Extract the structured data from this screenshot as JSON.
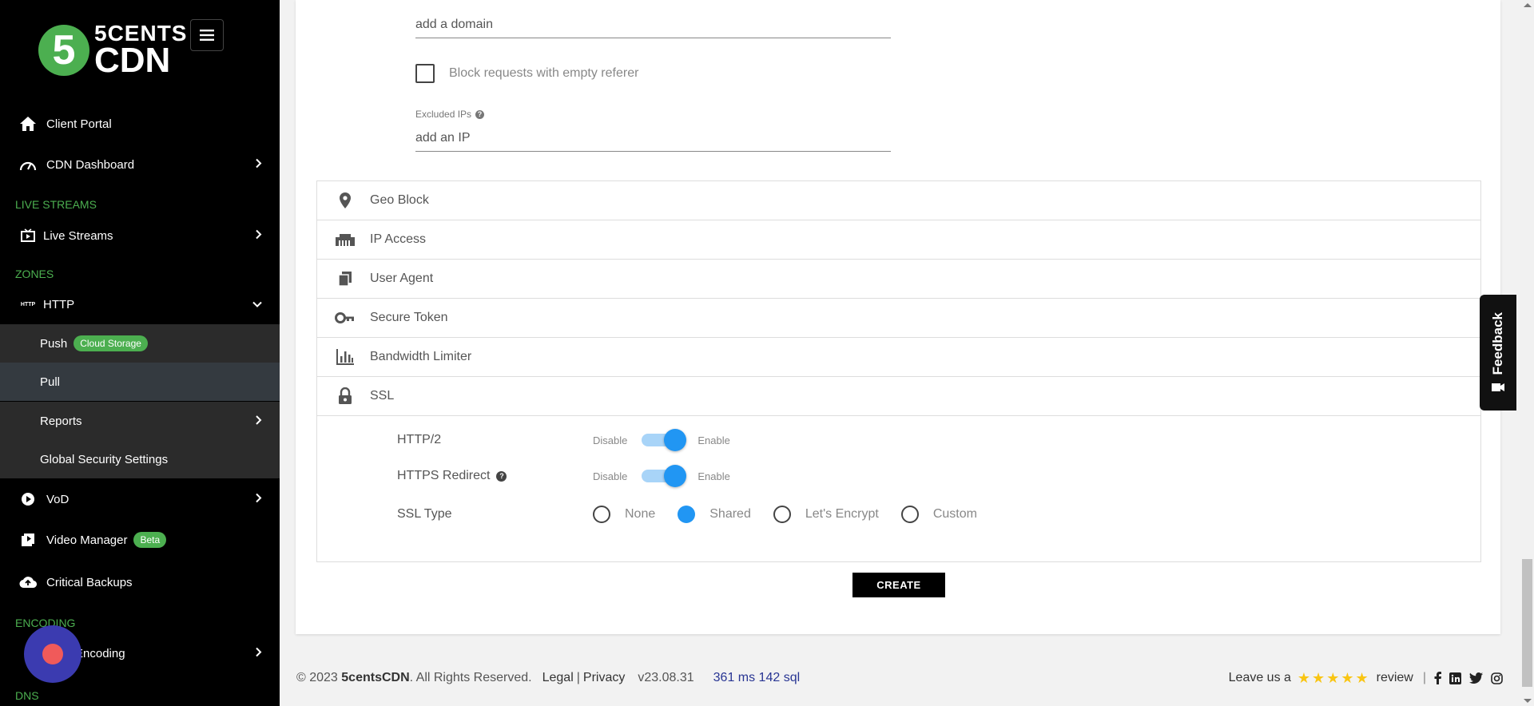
{
  "sidebar": {
    "logo": {
      "number": "5",
      "line1": "5CENTS",
      "line2": "CDN"
    },
    "items": {
      "client_portal": "Client Portal",
      "cdn_dashboard": "CDN Dashboard",
      "live_streams_section": "LIVE STREAMS",
      "live_streams": "Live Streams",
      "zones_section": "ZONES",
      "http": "HTTP",
      "push": "Push",
      "push_badge": "Cloud Storage",
      "pull": "Pull",
      "reports": "Reports",
      "global_security": "Global Security Settings",
      "vod": "VoD",
      "video_manager": "Video Manager",
      "video_manager_badge": "Beta",
      "critical_backups": "Critical Backups",
      "encoding_section": "ENCODING",
      "encoding": "Encoding",
      "dns_section": "DNS"
    }
  },
  "form": {
    "domain_placeholder": "add a domain",
    "block_empty_referer": "Block requests with empty referer",
    "excluded_ips_label": "Excluded IPs",
    "ip_placeholder": "add an IP"
  },
  "accordion": [
    "Geo Block",
    "IP Access",
    "User Agent",
    "Secure Token",
    "Bandwidth Limiter",
    "SSL"
  ],
  "ssl": {
    "http2_label": "HTTP/2",
    "https_redirect_label": "HTTPS Redirect",
    "disable": "Disable",
    "enable": "Enable",
    "ssl_type_label": "SSL Type",
    "options": {
      "none": "None",
      "shared": "Shared",
      "letsencrypt": "Let's Encrypt",
      "custom": "Custom"
    },
    "selected": "Shared"
  },
  "create_button": "CREATE",
  "feedback": "Feedback",
  "footer": {
    "copyright_prefix": "© 2023",
    "company": "5centsCDN",
    "rights": ". All Rights Reserved.",
    "legal": "Legal",
    "privacy": "Privacy",
    "version": "v23.08.31",
    "perf": "361 ms 142 sql",
    "leave_us": "Leave us a",
    "review": "review"
  },
  "colors": {
    "accent_green": "#4caf50",
    "toggle_blue": "#2196f3",
    "perf_blue": "#283593"
  }
}
